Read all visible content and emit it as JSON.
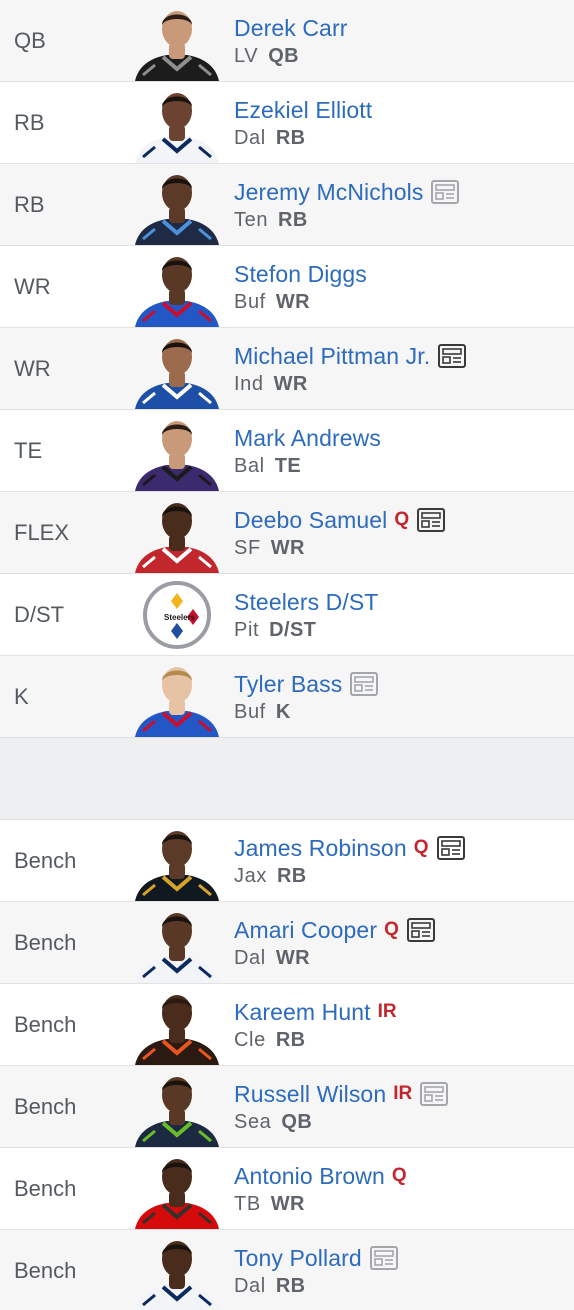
{
  "colors": {
    "link": "#2c6bbd",
    "status": "#c4262e",
    "muted": "#5f646b"
  },
  "starters": [
    {
      "slot": "QB",
      "name": "Derek Carr",
      "status": "",
      "news": "none",
      "team": "LV",
      "pos": "QB",
      "jersey": "#1c1c1c",
      "trim": "#8f8f8f",
      "skin": "#c99a7a",
      "hair": "#2a1e16"
    },
    {
      "slot": "RB",
      "name": "Ezekiel Elliott",
      "status": "",
      "news": "none",
      "team": "Dal",
      "pos": "RB",
      "jersey": "#f2f4f7",
      "trim": "#0b2a5c",
      "skin": "#6b4330",
      "hair": "#1a120d"
    },
    {
      "slot": "RB",
      "name": "Jeremy McNichols",
      "status": "",
      "news": "light",
      "team": "Ten",
      "pos": "RB",
      "jersey": "#1f2b45",
      "trim": "#4b92db",
      "skin": "#5c3a28",
      "hair": "#1a120d"
    },
    {
      "slot": "WR",
      "name": "Stefon Diggs",
      "status": "",
      "news": "none",
      "team": "Buf",
      "pos": "WR",
      "jersey": "#2357c6",
      "trim": "#c8102e",
      "skin": "#5a3826",
      "hair": "#1a120d"
    },
    {
      "slot": "WR",
      "name": "Michael Pittman Jr.",
      "status": "",
      "news": "dark",
      "team": "Ind",
      "pos": "WR",
      "jersey": "#1e4fa6",
      "trim": "#ffffff",
      "skin": "#9c6a4c",
      "hair": "#1a120d"
    },
    {
      "slot": "TE",
      "name": "Mark Andrews",
      "status": "",
      "news": "none",
      "team": "Bal",
      "pos": "TE",
      "jersey": "#3b2a6e",
      "trim": "#1a1a1a",
      "skin": "#c99a7a",
      "hair": "#2a1e16"
    },
    {
      "slot": "FLEX",
      "name": "Deebo Samuel",
      "status": "Q",
      "news": "dark",
      "team": "SF",
      "pos": "WR",
      "jersey": "#c1272d",
      "trim": "#ffffff",
      "skin": "#4a2c1d",
      "hair": "#1a120d"
    },
    {
      "slot": "D/ST",
      "name": "Steelers D/ST",
      "status": "",
      "news": "none",
      "team": "Pit",
      "pos": "D/ST",
      "logo": true
    },
    {
      "slot": "K",
      "name": "Tyler Bass",
      "status": "",
      "news": "light",
      "team": "Buf",
      "pos": "K",
      "jersey": "#2357c6",
      "trim": "#c8102e",
      "skin": "#e7c3a6",
      "hair": "#b58a4f"
    }
  ],
  "bench": [
    {
      "slot": "Bench",
      "name": "James Robinson",
      "status": "Q",
      "news": "dark",
      "team": "Jax",
      "pos": "RB",
      "jersey": "#101820",
      "trim": "#d7a22a",
      "skin": "#5c3a28",
      "hair": "#1a120d"
    },
    {
      "slot": "Bench",
      "name": "Amari Cooper",
      "status": "Q",
      "news": "dark",
      "team": "Dal",
      "pos": "WR",
      "jersey": "#f2f4f7",
      "trim": "#0b2a5c",
      "skin": "#5a3826",
      "hair": "#1a120d"
    },
    {
      "slot": "Bench",
      "name": "Kareem Hunt",
      "status": "IR",
      "news": "none",
      "team": "Cle",
      "pos": "RB",
      "jersey": "#2b1a12",
      "trim": "#e8561e",
      "skin": "#4a2c1d",
      "hair": "#2a1a10"
    },
    {
      "slot": "Bench",
      "name": "Russell Wilson",
      "status": "IR",
      "news": "light",
      "team": "Sea",
      "pos": "QB",
      "jersey": "#1b2a40",
      "trim": "#69be28",
      "skin": "#5a3826",
      "hair": "#1a120d"
    },
    {
      "slot": "Bench",
      "name": "Antonio Brown",
      "status": "Q",
      "news": "none",
      "team": "TB",
      "pos": "WR",
      "jersey": "#d50a0a",
      "trim": "#34302b",
      "skin": "#4a2c1d",
      "hair": "#1a120d"
    },
    {
      "slot": "Bench",
      "name": "Tony Pollard",
      "status": "",
      "news": "light",
      "team": "Dal",
      "pos": "RB",
      "jersey": "#f2f4f7",
      "trim": "#0b2a5c",
      "skin": "#4a2c1d",
      "hair": "#1a120d"
    }
  ]
}
